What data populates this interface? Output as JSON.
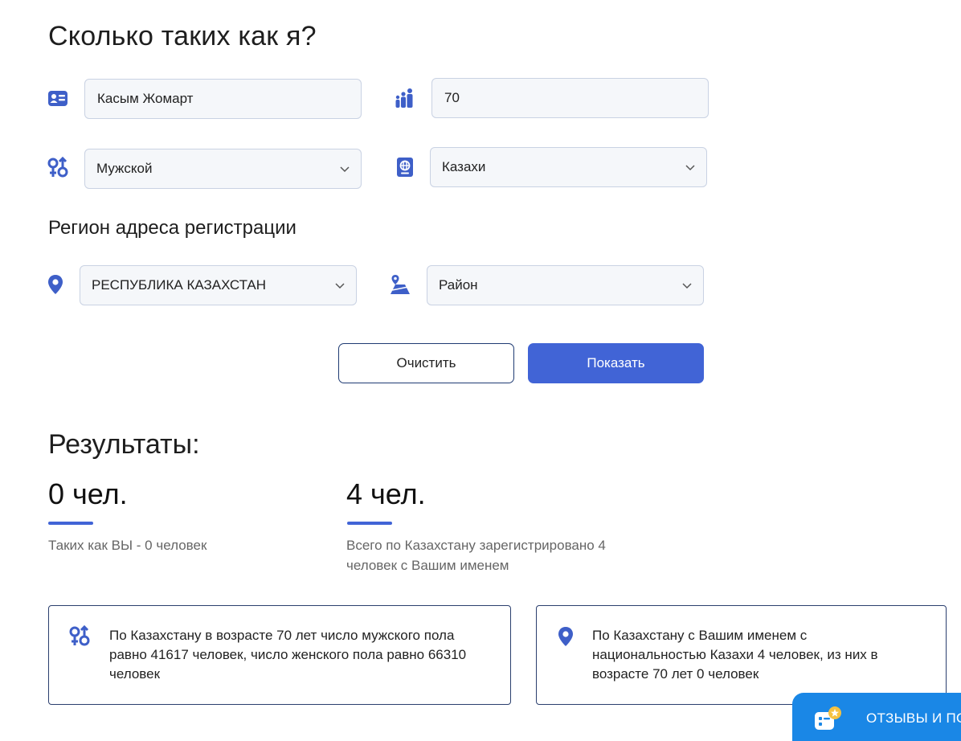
{
  "page": {
    "title": "Сколько таких как я?",
    "region_heading": "Регион адреса регистрации",
    "results_heading": "Результаты:"
  },
  "form": {
    "name_value": "Касым Жомарт",
    "age_value": "70",
    "gender_value": "Мужской",
    "nationality_value": "Казахи",
    "region_value": "РЕСПУБЛИКА КАЗАХСТАН",
    "district_value": "Район"
  },
  "buttons": {
    "clear_label": "Очистить",
    "show_label": "Показать"
  },
  "results": {
    "like_you": {
      "value": "0 чел.",
      "description": "Таких как ВЫ - 0 человек"
    },
    "same_name": {
      "value": "4 чел.",
      "description_line1": "Всего по Казахстану зарегистрировано 4",
      "description_line2": "человек с Вашим именем"
    }
  },
  "cards": {
    "gender_card": {
      "line1": "По Казахстану в возрасте 70 лет число мужского пола",
      "line2": "равно 41617 человек, число женского пола равно 66310",
      "line3": "человек"
    },
    "nationality_card": {
      "line1": "По Казахстану с Вашим именем с",
      "line2": "национальностью Казахи 4 человек, из них в",
      "line3": "возрасте 70 лет 0 человек"
    }
  },
  "feedback": {
    "label": "ОТЗЫВЫ И ПО"
  },
  "colors": {
    "accent": "#4164d6",
    "icon": "#3e5fc8",
    "border_dark": "#2b3f6e",
    "feedback_bg": "#1a87e6"
  },
  "icons": [
    "id-card-icon",
    "people-icon",
    "gender-icon",
    "passport-icon",
    "map-pin-icon",
    "map-icon",
    "chevron-down-icon",
    "chat-icon"
  ]
}
